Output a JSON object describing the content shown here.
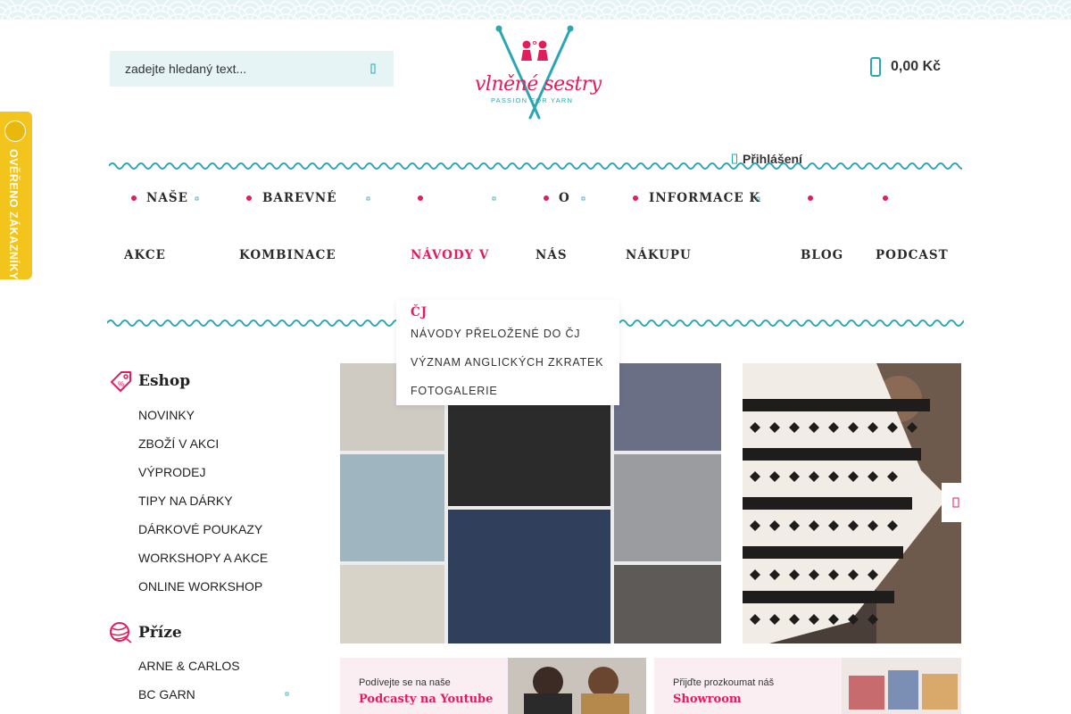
{
  "search": {
    "placeholder": "zadejte hledaný text..."
  },
  "logo": {
    "title": "vlněné sestry",
    "tagline": "PASSION FOR YARN"
  },
  "cart": {
    "total": "0,00 Kč"
  },
  "login": {
    "label": "Přihlášení"
  },
  "nav": {
    "items": [
      {
        "line1": "NAŠE",
        "line2": "AKCE"
      },
      {
        "line1": "BAREVNÉ",
        "line2": "KOMBINACE"
      },
      {
        "line1": "",
        "line2": "NÁVODY V",
        "line3": "ČJ"
      },
      {
        "line1": "O",
        "line2": "NÁS"
      },
      {
        "line1": "INFORMACE K",
        "line2": "NÁKUPU"
      },
      {
        "line1": "",
        "line2": "BLOG"
      },
      {
        "line1": "",
        "line2": "PODCAST"
      }
    ],
    "dropdown": [
      "NÁVODY PŘELOŽENÉ DO ČJ",
      "VÝZNAM ANGLICKÝCH ZKRATEK",
      "FOTOGALERIE"
    ]
  },
  "badge": {
    "text": "OVĚŘENO ZÁKAZNÍKY"
  },
  "sidebar": {
    "eshop": {
      "title": "Eshop",
      "items": [
        "NOVINKY",
        "ZBOŽÍ V AKCI",
        "VÝPRODEJ",
        "TIPY NA DÁRKY",
        "DÁRKOVÉ POUKAZY",
        "WORKSHOPY A AKCE",
        "ONLINE WORKSHOP"
      ]
    },
    "yarn": {
      "title": "Příze",
      "items": [
        "ARNE & CARLOS",
        "BC GARN"
      ]
    }
  },
  "promos": [
    {
      "small": "Podívejte se na naše",
      "big": "Podcasty na Youtube"
    },
    {
      "small": "Přijďte prozkoumat náš",
      "big": "Showroom"
    }
  ],
  "colors": {
    "accent": "#e21d5c",
    "teal": "#2aa6b4",
    "badge": "#f3c41c"
  }
}
